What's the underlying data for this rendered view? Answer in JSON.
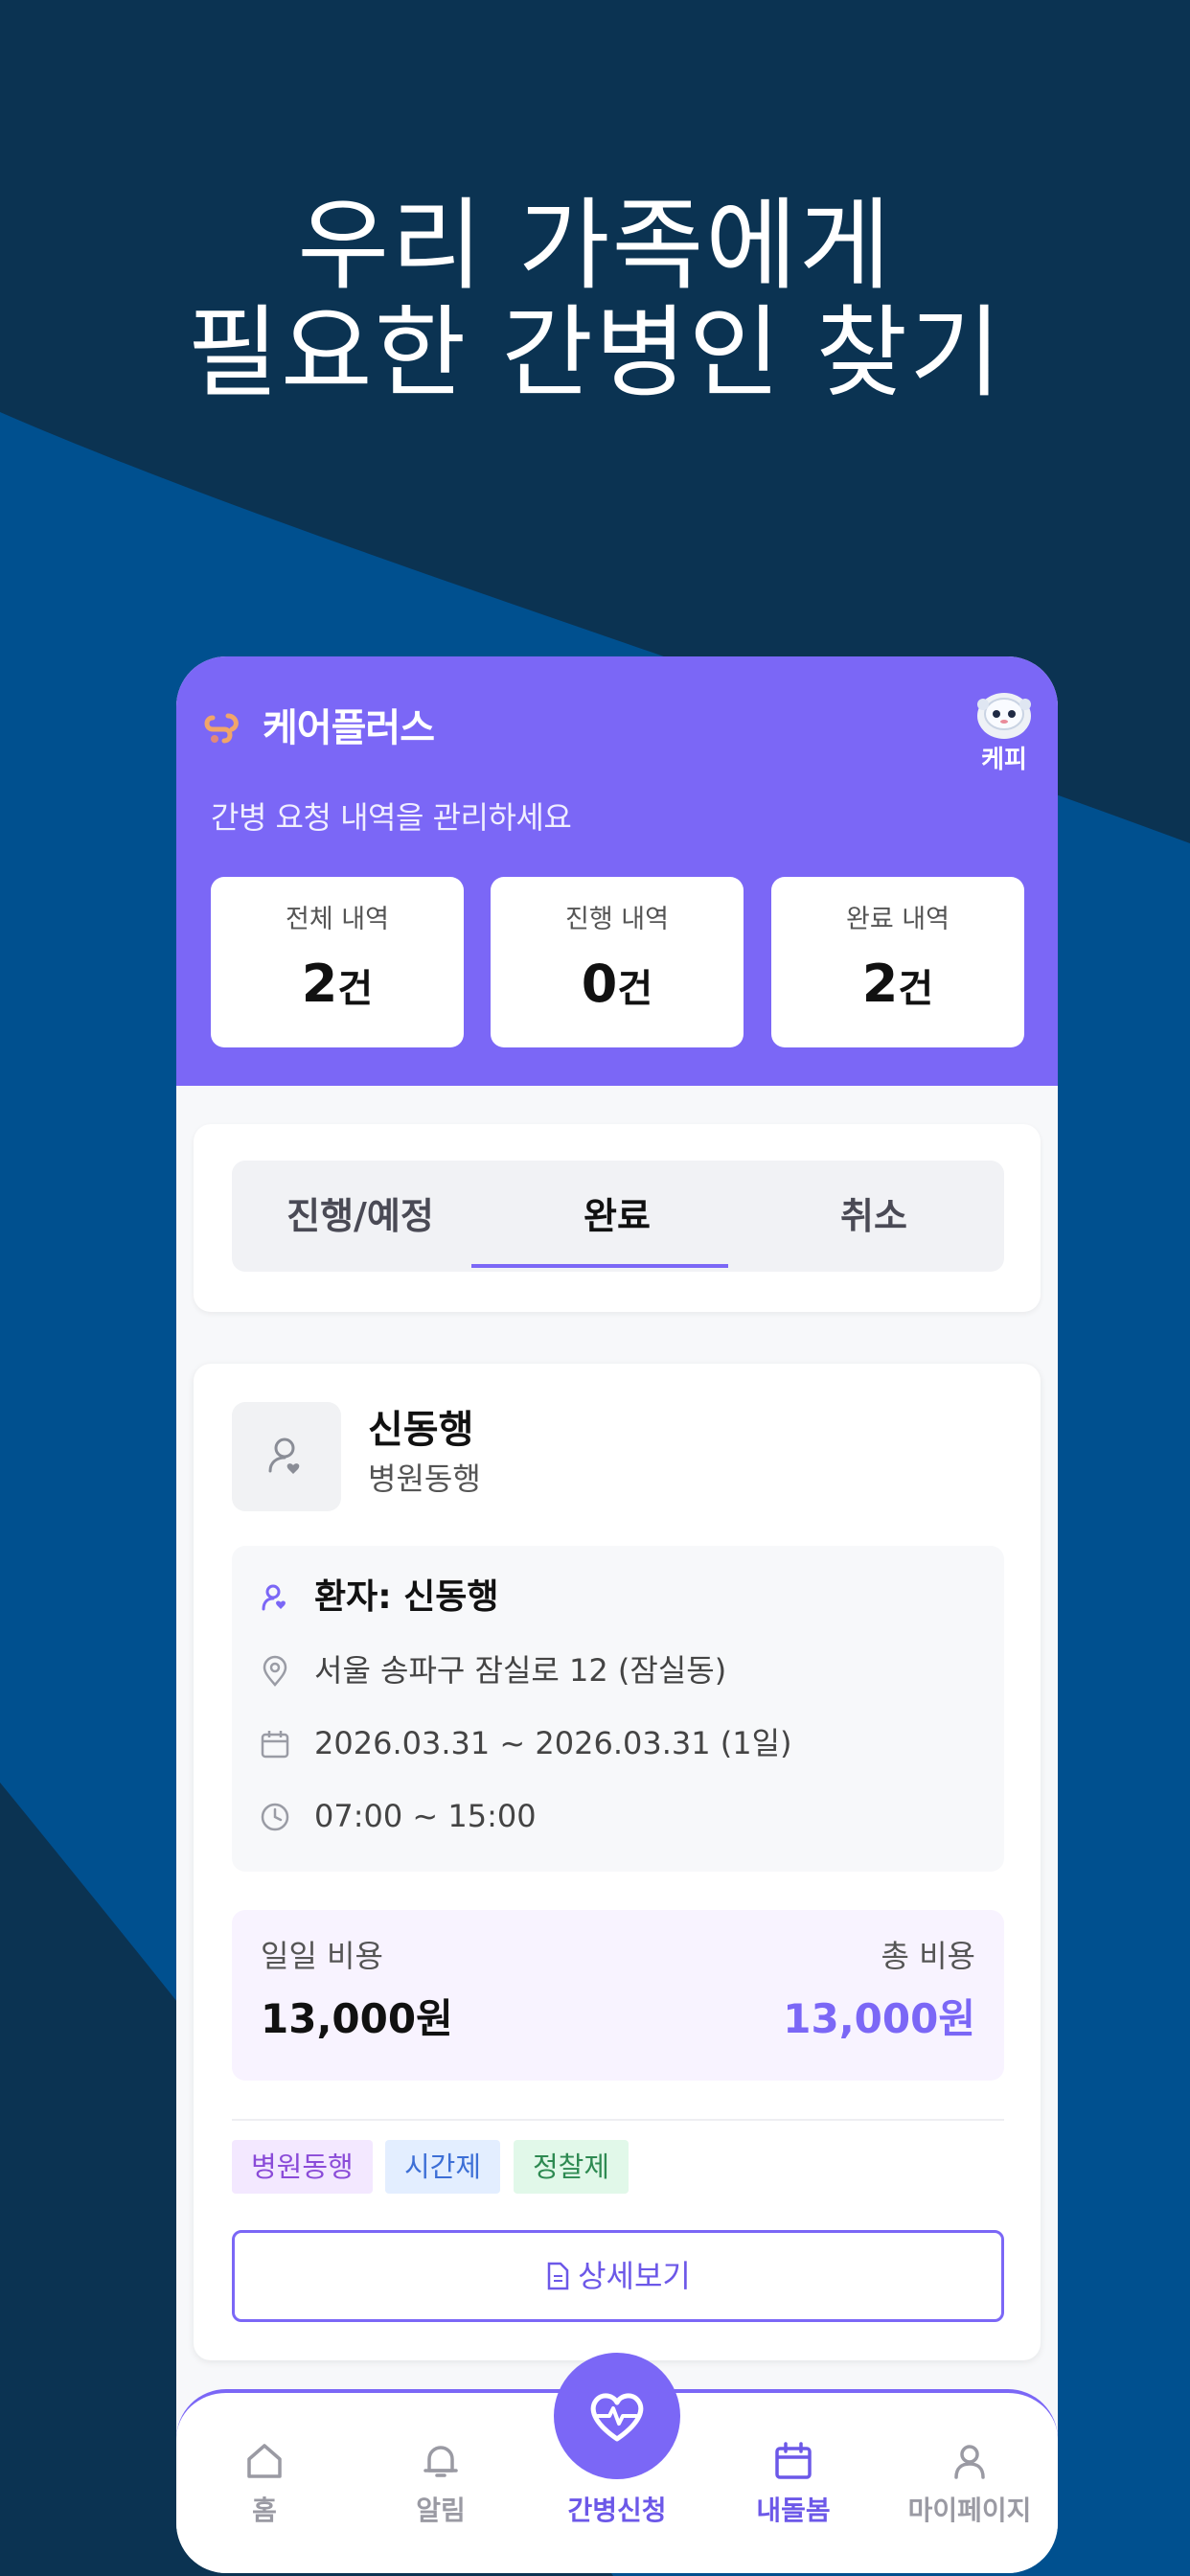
{
  "headline": {
    "line1": "우리 가족에게",
    "line2": "필요한 간병인 찾기"
  },
  "app": {
    "name": "케어플러스",
    "user_name": "케피",
    "subtitle": "간병 요청 내역을 관리하세요"
  },
  "stats": [
    {
      "label": "전체 내역",
      "value": "2",
      "unit": "건"
    },
    {
      "label": "진행 내역",
      "value": "0",
      "unit": "건"
    },
    {
      "label": "완료 내역",
      "value": "2",
      "unit": "건"
    }
  ],
  "tabs": [
    {
      "label": "진행/예정"
    },
    {
      "label": "완료"
    },
    {
      "label": "취소"
    }
  ],
  "active_tab": "완료",
  "record": {
    "title": "신동행",
    "subtitle": "병원동행",
    "patient": "환자: 신동행",
    "address": "서울 송파구 잠실로 12 (잠실동)",
    "dates": "2026.03.31 ~ 2026.03.31 (1일)",
    "time": "07:00 ~ 15:00",
    "daily_fee_label": "일일 비용",
    "daily_fee": "13,000원",
    "total_fee_label": "총 비용",
    "total_fee": "13,000원",
    "tags": [
      "병원동행",
      "시간제",
      "정찰제"
    ],
    "detail_button": "상세보기"
  },
  "nav": {
    "items": [
      {
        "label": "홈",
        "icon": "home-icon"
      },
      {
        "label": "알림",
        "icon": "bell-icon"
      },
      {
        "label": "간병신청",
        "icon": "heart-pulse-icon"
      },
      {
        "label": "내돌봄",
        "icon": "calendar-icon"
      },
      {
        "label": "마이페이지",
        "icon": "user-icon"
      }
    ]
  },
  "colors": {
    "background": "#0b3352",
    "background_wave": "#00508f",
    "accent": "#7b67f6",
    "accent_text": "#6c58e8"
  }
}
